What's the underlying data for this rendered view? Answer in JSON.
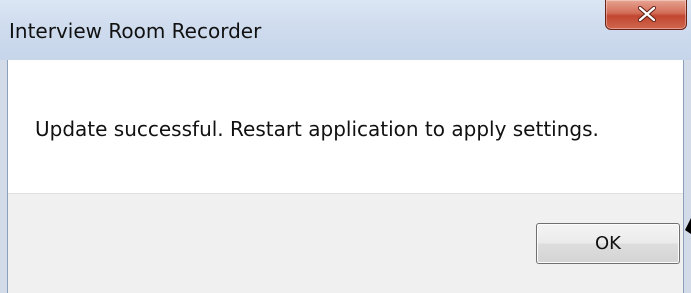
{
  "window": {
    "title": "Interview Room Recorder"
  },
  "titlebar_controls": {
    "close_icon": "close-x-icon",
    "close_color": "#c8462f"
  },
  "message": {
    "text": "Update successful. Restart application to apply settings."
  },
  "buttons": {
    "ok_label": "OK"
  },
  "colors": {
    "title_bar": "#cfdcee",
    "footer": "#f0f0f0",
    "content": "#ffffff"
  }
}
